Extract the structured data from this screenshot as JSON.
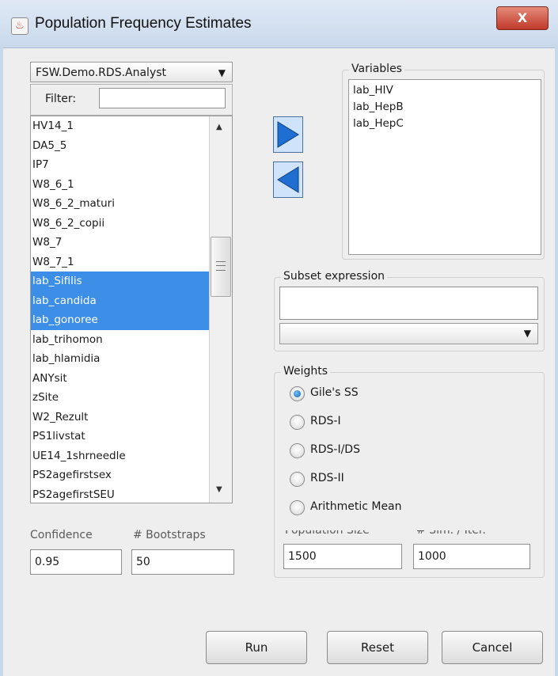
{
  "window": {
    "title": "Population Frequency Estimates",
    "close_label": "X"
  },
  "dataset": {
    "selected": "FSW.Demo.RDS.Analyst"
  },
  "filter": {
    "label": "Filter:",
    "value": ""
  },
  "variable_list": {
    "items": [
      {
        "label": "HV14_1",
        "selected": false
      },
      {
        "label": "DA5_5",
        "selected": false
      },
      {
        "label": "IP7",
        "selected": false
      },
      {
        "label": "W8_6_1",
        "selected": false
      },
      {
        "label": "W8_6_2_maturi",
        "selected": false
      },
      {
        "label": "W8_6_2_copii",
        "selected": false
      },
      {
        "label": "W8_7",
        "selected": false
      },
      {
        "label": "W8_7_1",
        "selected": false
      },
      {
        "label": "lab_Sifilis",
        "selected": true
      },
      {
        "label": "lab_candida",
        "selected": true
      },
      {
        "label": "lab_gonoree",
        "selected": true
      },
      {
        "label": "lab_trihomon",
        "selected": false
      },
      {
        "label": "lab_hlamidia",
        "selected": false
      },
      {
        "label": "ANYsit",
        "selected": false
      },
      {
        "label": "zSite",
        "selected": false
      },
      {
        "label": "W2_Rezult",
        "selected": false
      },
      {
        "label": "PS1livstat",
        "selected": false
      },
      {
        "label": "UE14_1shrneedle",
        "selected": false
      },
      {
        "label": "PS2agefirstsex",
        "selected": false
      },
      {
        "label": "PS2agefirstSEU",
        "selected": false
      }
    ]
  },
  "variables_panel": {
    "label": "Variables",
    "items": [
      "lab_HIV",
      "lab_HepB",
      "lab_HepC"
    ]
  },
  "subset": {
    "label": "Subset expression",
    "value": "",
    "combo_value": ""
  },
  "weights": {
    "label": "Weights",
    "options": [
      {
        "label": "Gile's SS",
        "checked": true
      },
      {
        "label": "RDS-I",
        "checked": false
      },
      {
        "label": "RDS-I/DS",
        "checked": false
      },
      {
        "label": "RDS-II",
        "checked": false
      },
      {
        "label": "Arithmetic Mean",
        "checked": false
      }
    ]
  },
  "confidence": {
    "label": "Confidence",
    "value": "0.95"
  },
  "bootstraps": {
    "label": "# Bootstraps",
    "value": "50"
  },
  "population_size": {
    "label": "Population Size",
    "value": "1500"
  },
  "sim_iter": {
    "label": "# Sim. / Iter.",
    "value": "1000"
  },
  "buttons": {
    "run": "Run",
    "reset": "Reset",
    "cancel": "Cancel"
  },
  "colors": {
    "selection": "#3d8ee6",
    "accent_arrow": "#1e6fd1",
    "close": "#c0392b"
  }
}
